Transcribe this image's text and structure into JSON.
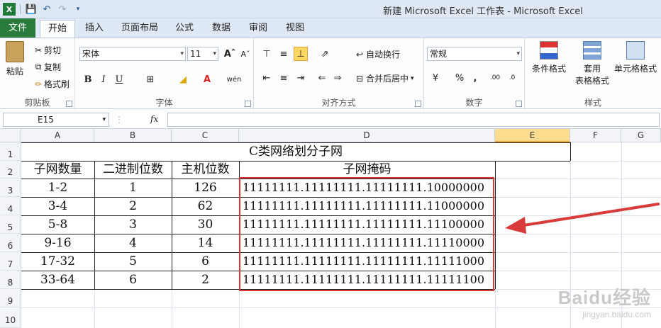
{
  "window": {
    "title": "新建 Microsoft Excel 工作表 - Microsoft Excel"
  },
  "ribbon_tabs": [
    "文件",
    "开始",
    "插入",
    "页面布局",
    "公式",
    "数据",
    "审阅",
    "视图"
  ],
  "clipboard": {
    "paste": "粘贴",
    "cut": "剪切",
    "copy": "复制",
    "format_painter": "格式刷",
    "group": "剪贴板"
  },
  "font": {
    "name": "宋体",
    "size": "11",
    "group": "字体",
    "bold": "B",
    "italic": "I",
    "underline": "U"
  },
  "alignment": {
    "wrap": "自动换行",
    "merge": "合并后居中",
    "group": "对齐方式"
  },
  "number": {
    "format": "常规",
    "percent": "%",
    "comma": ",",
    "group": "数字"
  },
  "styles": {
    "conditional": "条件格式",
    "table_line1": "套用",
    "table_line2": "表格格式",
    "cell_styles": "单元格格式",
    "group": "样式"
  },
  "formula_bar": {
    "cell_ref": "E15",
    "fx": "fx",
    "value": ""
  },
  "columns": [
    "A",
    "B",
    "C",
    "D",
    "E",
    "F",
    "G"
  ],
  "rows": [
    "1",
    "2",
    "3",
    "4",
    "5",
    "6",
    "7",
    "8",
    "9",
    "10"
  ],
  "table": {
    "title": "C类网络划分子网",
    "headers": [
      "子网数量",
      "二进制位数",
      "主机位数",
      "子网掩码"
    ],
    "rows": [
      [
        "1-2",
        "1",
        "126",
        "11111111.11111111.11111111.10000000"
      ],
      [
        "3-4",
        "2",
        "62",
        "11111111.11111111.11111111.11000000"
      ],
      [
        "5-8",
        "3",
        "30",
        "11111111.11111111.11111111.11100000"
      ],
      [
        "9-16",
        "4",
        "14",
        "11111111.11111111.11111111.11110000"
      ],
      [
        "17-32",
        "5",
        "6",
        "11111111.11111111.11111111.11111000"
      ],
      [
        "33-64",
        "6",
        "2",
        "11111111.11111111.11111111.11111100"
      ]
    ]
  },
  "watermark": {
    "brand": "Baidu经验",
    "url": "jingyan.baidu.com"
  },
  "colors": {
    "file_tab": "#2a7a3b",
    "highlight_box": "#d93b3b",
    "selected_col": "#fcdc8e"
  }
}
